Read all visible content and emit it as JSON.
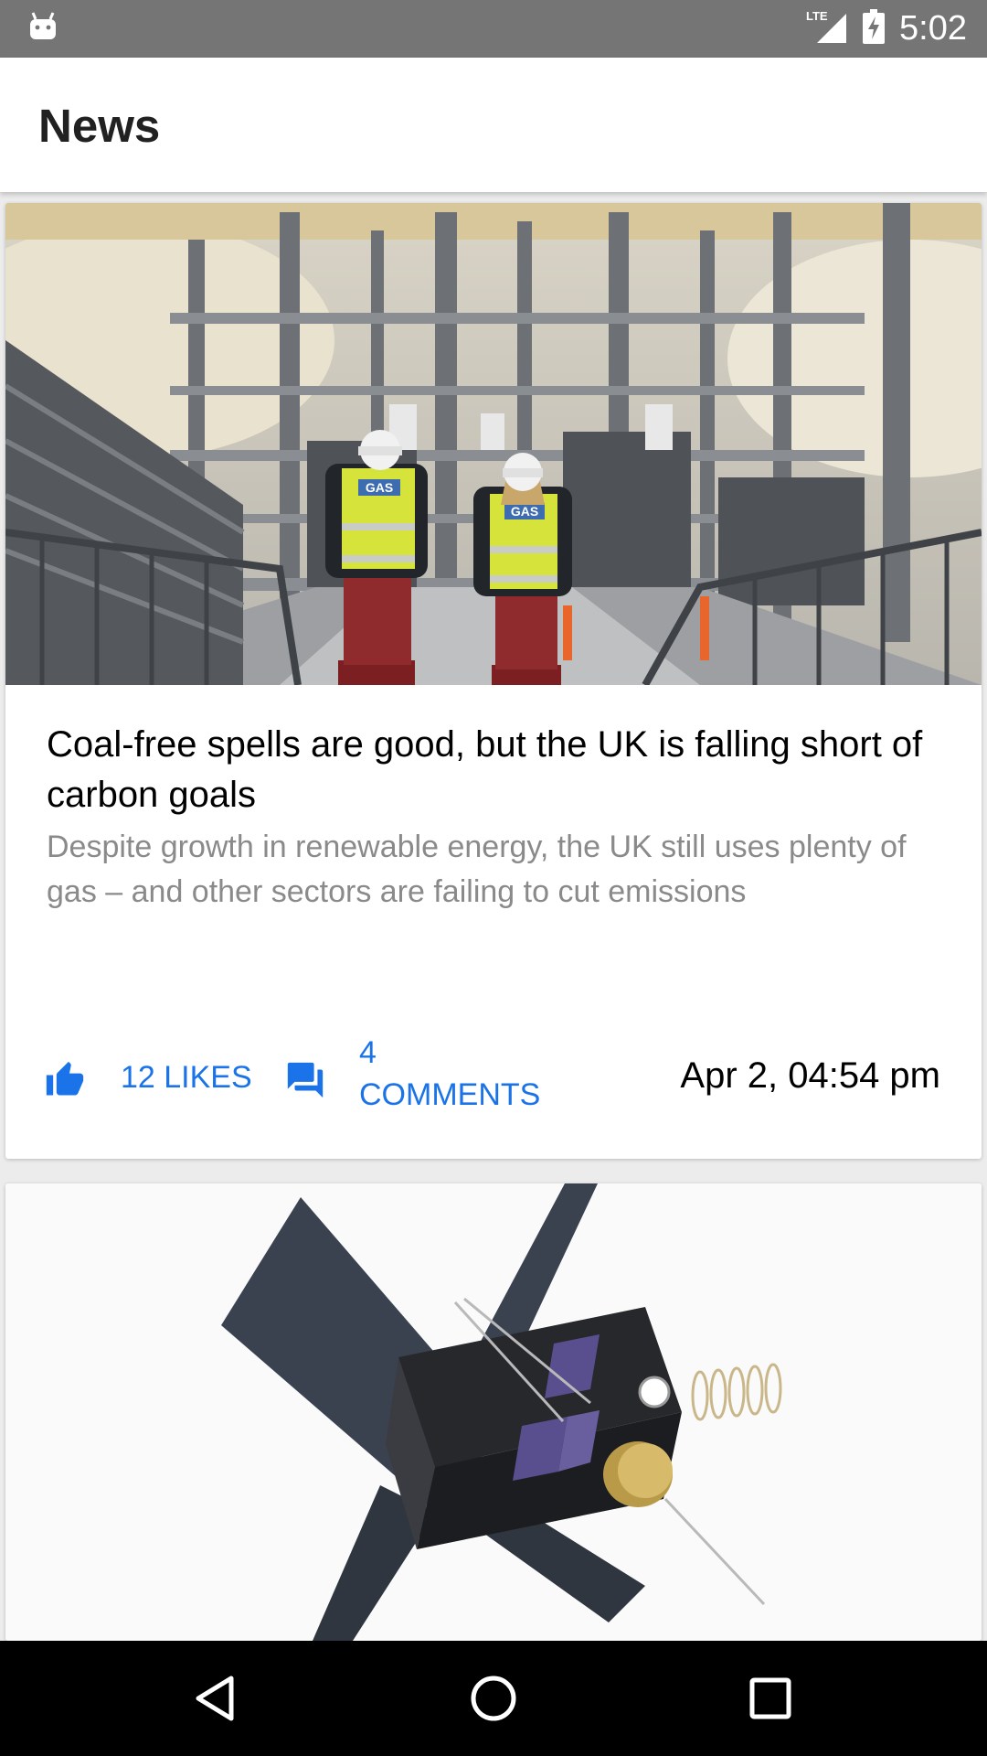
{
  "status_bar": {
    "time": "5:02",
    "network_label": "LTE",
    "icons": [
      "android-notification-icon",
      "signal-icon",
      "battery-charging-icon"
    ]
  },
  "app_bar": {
    "title": "News"
  },
  "articles": [
    {
      "image": "refinery-workers-image",
      "title": "Coal-free spells are good, but the UK is falling short of carbon goals",
      "description": "Despite growth in renewable energy, the UK still uses plenty of gas – and other sectors are failing to cut emissions",
      "likes_label": "12 LIKES",
      "comments_count": "4",
      "comments_label": "COMMENTS",
      "date": "Apr 2, 04:54 pm",
      "vest_text": "GAS"
    },
    {
      "image": "satellite-image"
    }
  ],
  "nav_bar": {
    "buttons": [
      "back-icon",
      "home-icon",
      "recents-icon"
    ]
  },
  "colors": {
    "status_bar": "#757575",
    "accent": "#1a73e8",
    "description": "#8a8a8a",
    "nav_bar": "#000000"
  }
}
